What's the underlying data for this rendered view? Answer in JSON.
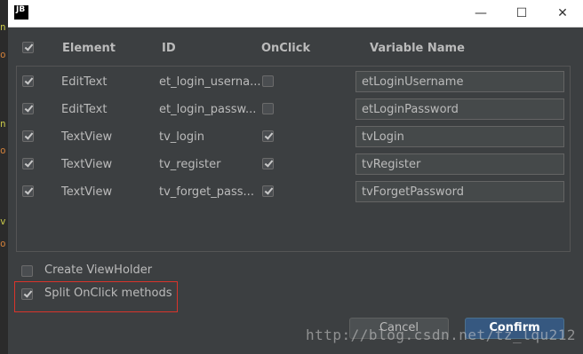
{
  "window": {
    "icon_text": "JB",
    "minimize_symbol": "—",
    "maximize_symbol": "☐",
    "close_symbol": "✕"
  },
  "side_fragments": [
    "n",
    "o",
    "n",
    "o",
    "v",
    "o"
  ],
  "table": {
    "headers": {
      "element": "Element",
      "id": "ID",
      "onclick": "OnClick",
      "variable_name": "Variable Name"
    },
    "rows": [
      {
        "checked": true,
        "element": "EditText",
        "id": "et_login_userna...",
        "onclick": false,
        "variable_name": "etLoginUsername"
      },
      {
        "checked": true,
        "element": "EditText",
        "id": "et_login_passw...",
        "onclick": false,
        "variable_name": "etLoginPassword"
      },
      {
        "checked": true,
        "element": "TextView",
        "id": "tv_login",
        "onclick": true,
        "variable_name": "tvLogin"
      },
      {
        "checked": true,
        "element": "TextView",
        "id": "tv_register",
        "onclick": true,
        "variable_name": "tvRegister"
      },
      {
        "checked": true,
        "element": "TextView",
        "id": "tv_forget_pass...",
        "onclick": true,
        "variable_name": "tvForgetPassword"
      }
    ]
  },
  "options": {
    "create_viewholder": {
      "label": "Create ViewHolder",
      "checked": false
    },
    "split_onclick": {
      "label": "Split OnClick methods",
      "checked": true
    }
  },
  "buttons": {
    "cancel": "Cancel",
    "confirm": "Confirm"
  },
  "watermark": "http://blog.csdn.net/tz_lqu212",
  "colors": {
    "background": "#3c3f41",
    "accent": "#365880",
    "highlight": "#d9342b"
  }
}
